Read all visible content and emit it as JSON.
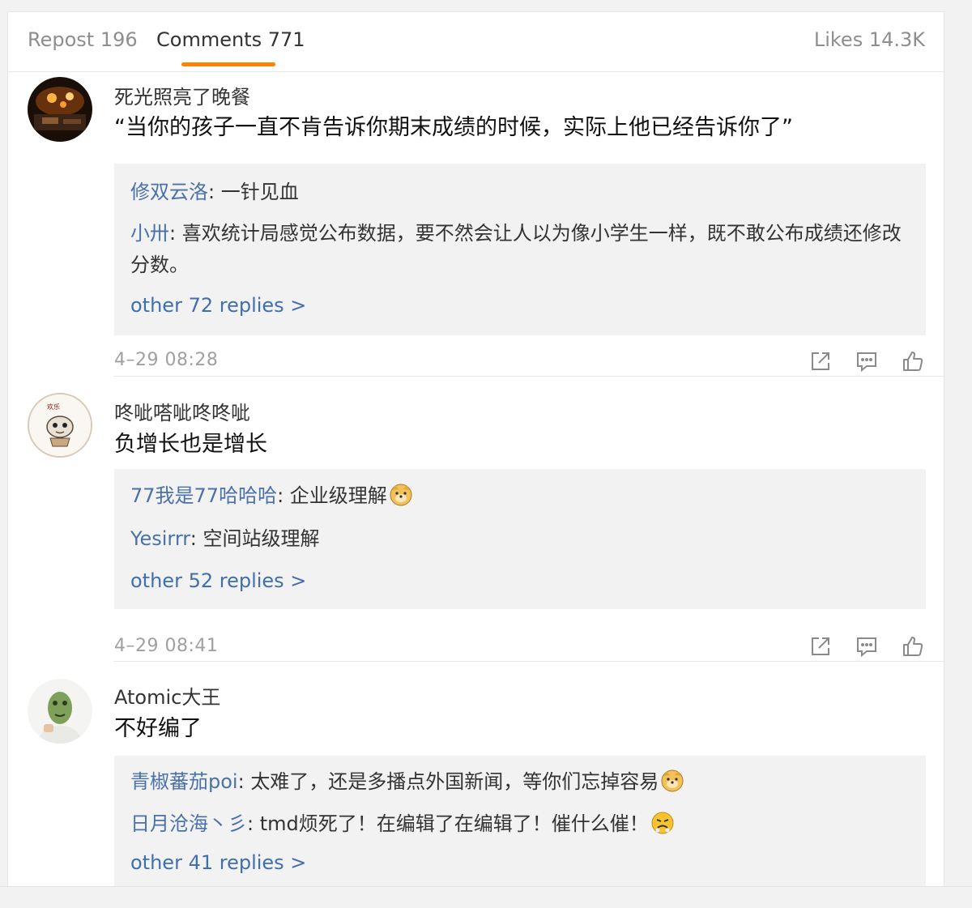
{
  "tabs": {
    "repost": "Repost 196",
    "comments": "Comments 771",
    "likes": "Likes 14.3K"
  },
  "comments": [
    {
      "user": "死光照亮了晚餐",
      "text": "“当你的孩子一直不肯告诉你期末成绩的时候，实际上他已经告诉你了”",
      "replies": [
        {
          "name": "修双云洛",
          "sep": ": ",
          "text": "一针见血"
        },
        {
          "name": "小卅",
          "sep": ": ",
          "text": "喜欢统计局感觉公布数据，要不然会让人以为像小学生一样，既不敢公布成绩还修改分数。"
        }
      ],
      "more": "other 72 replies >",
      "time": "4–29 08:28"
    },
    {
      "user": "咚呲嗒呲咚咚呲",
      "text": "负增长也是增长",
      "replies": [
        {
          "name": "77我是77哈哈哈",
          "sep": ": ",
          "text": "企业级理解",
          "emoji": "doge-emoji"
        },
        {
          "name": "Yesirrr",
          "sep": ": ",
          "text": "空间站级理解"
        }
      ],
      "more": "other 52 replies >",
      "time": "4–29 08:41"
    },
    {
      "user": "Atomic大王",
      "text": "不好编了",
      "replies": [
        {
          "name": "青椒蕃茄poi",
          "sep": ": ",
          "text": "太难了，还是多播点外国新闻，等你们忘掉容易",
          "emoji": "doge-emoji"
        },
        {
          "name": "日月沧海丶彡",
          "sep": ": ",
          "text": "tmd烦死了！在编辑了在编辑了！催什么催！",
          "emoji": "angry-emoji"
        }
      ],
      "more": "other 41 replies >"
    }
  ],
  "icons": {
    "share": "share-icon",
    "comment": "comment-icon",
    "like": "thumbs-up-icon"
  },
  "colors": {
    "accent": "#ff8200",
    "link": "#4a72a8",
    "reply_bg": "#f2f2f2"
  }
}
